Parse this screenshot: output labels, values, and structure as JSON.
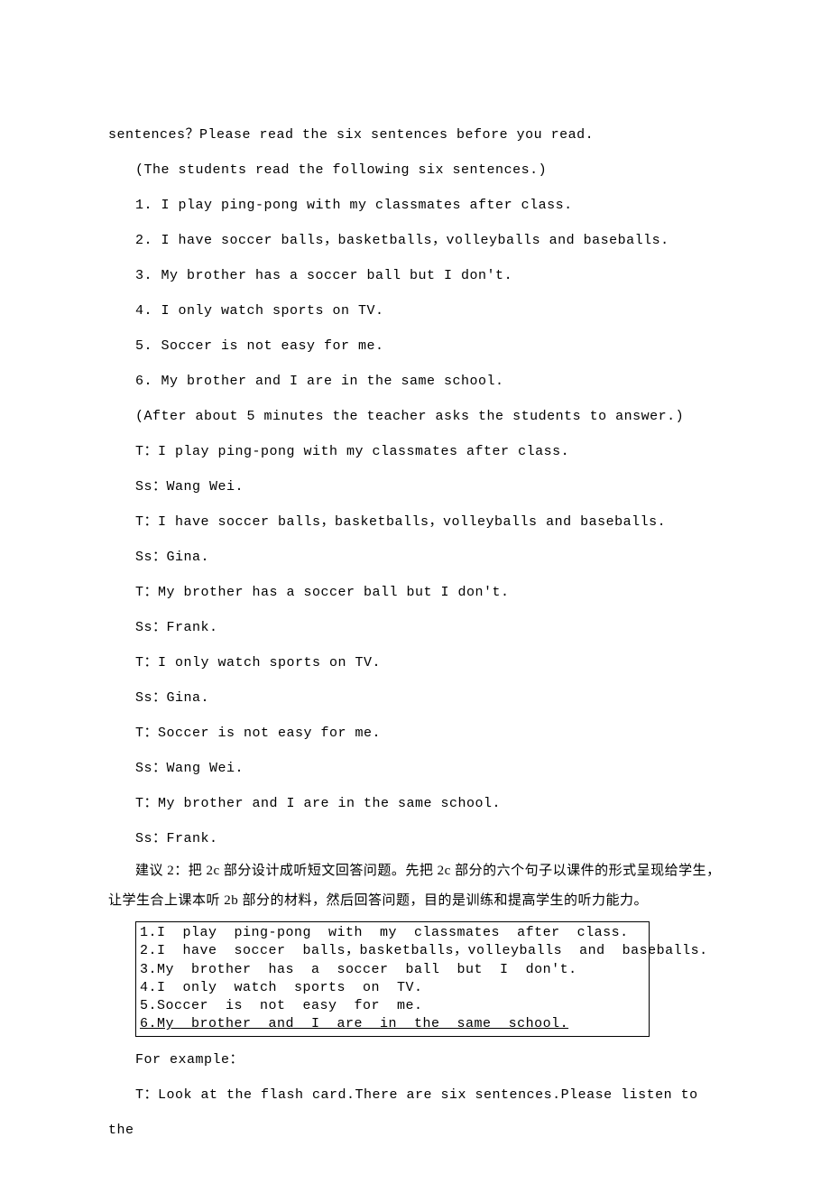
{
  "lines": {
    "l0": "sentences？Please read the six sentences before you read.",
    "l1": "(The students read the following six sentences.)",
    "l2": "1. I play ping-pong with my classmates after class.",
    "l3": "2. I have soccer balls，basketballs，volleyballs and baseballs.",
    "l4": "3. My brother has a soccer ball but I don't.",
    "l5": "4. I only watch sports on TV.",
    "l6": "5. Soccer is not easy for me.",
    "l7": "6. My brother and I are in the same school.",
    "l8": "(After about 5 minutes the teacher asks the students to answer.)",
    "l9": "T：I play ping-pong with my classmates after class.",
    "l10": "Ss：Wang Wei.",
    "l11": "T：I have soccer balls，basketballs，volleyballs and baseballs.",
    "l12": "Ss：Gina.",
    "l13": "T：My brother has a soccer ball but I don't.",
    "l14": "Ss：Frank.",
    "l15": "T：I only watch sports on TV.",
    "l16": "Ss：Gina.",
    "l17": "T：Soccer is not easy for me.",
    "l18": "Ss：Wang Wei.",
    "l19": "T：My brother and I are in the same school.",
    "l20": "Ss：Frank."
  },
  "suggestion": "建议 2：把 2c 部分设计成听短文回答问题。先把 2c 部分的六个句子以课件的形式呈现给学生，让学生合上课本听 2b 部分的材料，然后回答问题，目的是训练和提高学生的听力能力。",
  "box": {
    "b1": "1.I  play  ping-pong  with  my  classmates  after  class.",
    "b2": "2.I  have  soccer  balls，basketballs，volleyballs  and  baseballs.",
    "b3": "3.My  brother  has  a  soccer  ball  but  I  don't.",
    "b4": "4.I  only  watch  sports  on  TV.",
    "b5": "5.Soccer  is  not  easy  for  me.",
    "b6": "6.My  brother  and  I  are  in  the  same  school."
  },
  "after": {
    "a1": "For example：",
    "a2": "T：Look at the flash card.There are six sentences.Please listen to the"
  }
}
